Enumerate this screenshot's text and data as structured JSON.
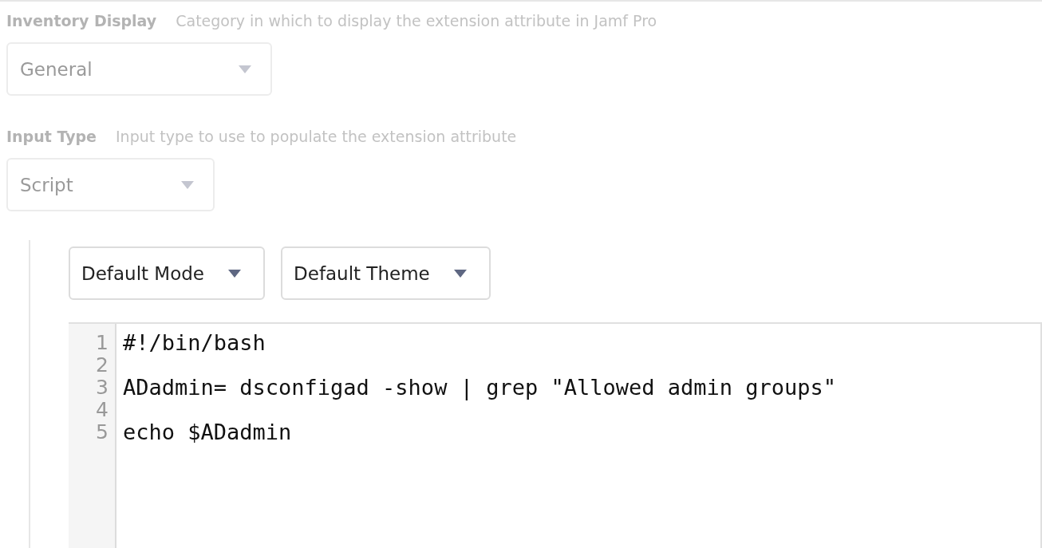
{
  "fields": [
    {
      "label": "Inventory Display",
      "hint": "Category in which to display the extension attribute in Jamf Pro",
      "value": "General",
      "disabled": true
    },
    {
      "label": "Input Type",
      "hint": "Input type to use to populate the extension attribute",
      "value": "Script",
      "disabled": true
    }
  ],
  "editor": {
    "toolbar": [
      {
        "value": "Default Mode"
      },
      {
        "value": "Default Theme"
      }
    ],
    "lines": [
      {
        "number": "1",
        "code": "#!/bin/bash"
      },
      {
        "number": "2"
      },
      {
        "number": "3",
        "code": "ADadmin= dsconfigad -show | grep \"Allowed admin groups\""
      },
      {
        "number": "4"
      },
      {
        "number": "5",
        "code": "echo $ADadmin"
      }
    ]
  }
}
